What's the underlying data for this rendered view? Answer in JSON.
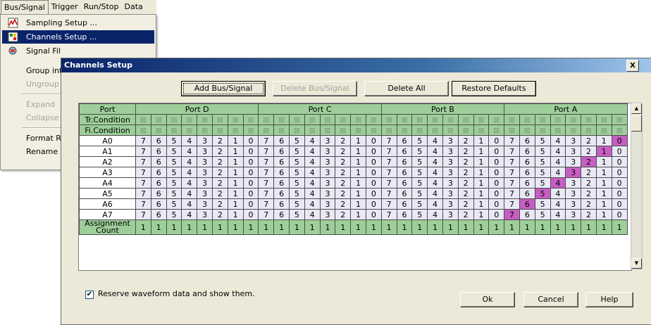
{
  "menubar": {
    "items": [
      "Bus/Signal",
      "Trigger",
      "Run/Stop",
      "Data"
    ]
  },
  "menu": {
    "items": [
      {
        "label": "Sampling Setup ...",
        "state": "normal",
        "icon": "sampling-icon"
      },
      {
        "label": "Channels Setup ...",
        "state": "selected",
        "icon": "channels-icon"
      },
      {
        "label": "Signal Fil",
        "state": "normal",
        "icon": "filter-icon"
      },
      {
        "label": "Group int",
        "state": "normal"
      },
      {
        "label": "Ungroup",
        "state": "disabled"
      },
      {
        "label": "Expand",
        "state": "disabled"
      },
      {
        "label": "Collapse",
        "state": "disabled"
      },
      {
        "label": "Format R",
        "state": "normal"
      },
      {
        "label": "Rename",
        "state": "normal"
      }
    ]
  },
  "dialog": {
    "title": "Channels Setup",
    "close_label": "X",
    "buttons": {
      "add": "Add Bus/Signal",
      "delete": "Delete Bus/Signal",
      "delete_all": "Delete All",
      "restore": "Restore Defaults",
      "ok": "Ok",
      "cancel": "Cancel",
      "help": "Help"
    },
    "checkbox": {
      "label": "Reserve waveform data and show them.",
      "checked": true,
      "mark": "✔"
    },
    "grid": {
      "port_header": "Port",
      "ports": [
        "Port D",
        "Port C",
        "Port B",
        "Port A"
      ],
      "tr_condition": "Tr.Condition",
      "fi_condition": "Fi.Condition",
      "cond_mark": "⊠",
      "bits": [
        "7",
        "6",
        "5",
        "4",
        "3",
        "2",
        "1",
        "0"
      ],
      "rows": [
        {
          "name": "A0",
          "highlight": 31
        },
        {
          "name": "A1",
          "highlight": 30
        },
        {
          "name": "A2",
          "highlight": 29
        },
        {
          "name": "A3",
          "highlight": 28
        },
        {
          "name": "A4",
          "highlight": 27
        },
        {
          "name": "A5",
          "highlight": 26
        },
        {
          "name": "A6",
          "highlight": 25
        },
        {
          "name": "A7",
          "highlight": 24
        }
      ],
      "count_label": "Assignment Count",
      "counts": [
        "1",
        "1",
        "1",
        "1",
        "1",
        "1",
        "1",
        "1",
        "1",
        "1",
        "1",
        "1",
        "1",
        "1",
        "1",
        "1",
        "1",
        "1",
        "1",
        "1",
        "1",
        "1",
        "1",
        "1",
        "1",
        "1",
        "1",
        "1",
        "1",
        "1",
        "1",
        "1"
      ]
    }
  }
}
